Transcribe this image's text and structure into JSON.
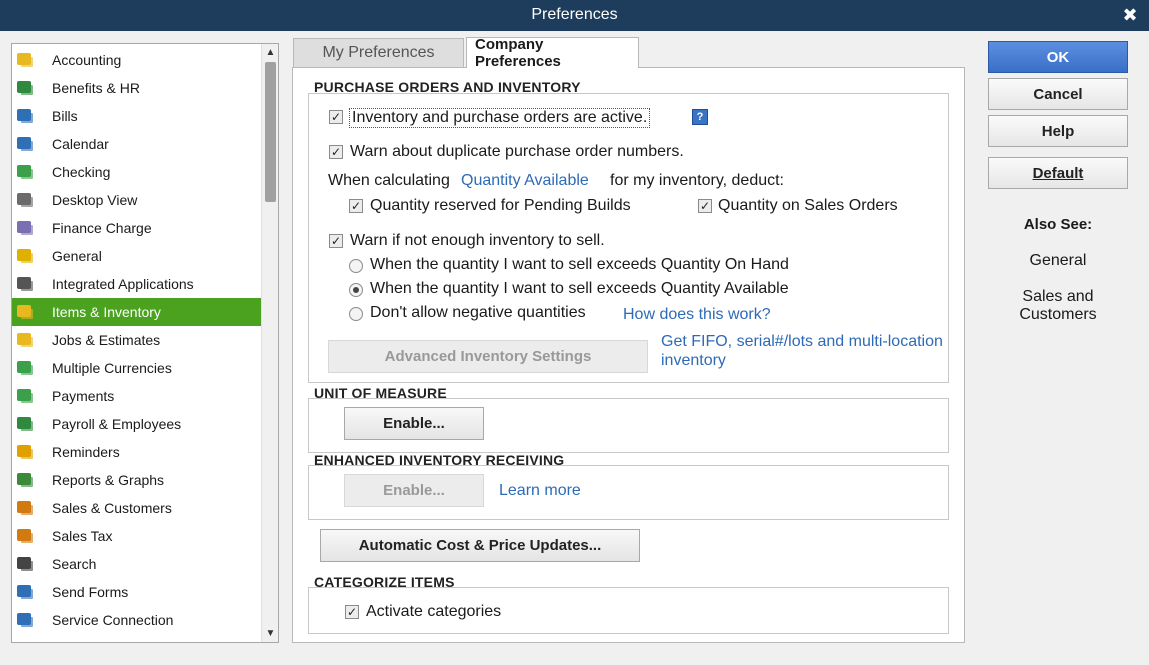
{
  "window": {
    "title": "Preferences",
    "close_glyph": "✖"
  },
  "sidebar": {
    "items": [
      {
        "label": "Accounting",
        "icon": "accounting-icon",
        "color": "#e8b820"
      },
      {
        "label": "Benefits & HR",
        "icon": "benefits-hr-icon",
        "color": "#2f8a3e"
      },
      {
        "label": "Bills",
        "icon": "bills-icon",
        "color": "#2f6fb5"
      },
      {
        "label": "Calendar",
        "icon": "calendar-icon",
        "color": "#2f6fb5"
      },
      {
        "label": "Checking",
        "icon": "checking-icon",
        "color": "#3aa04a"
      },
      {
        "label": "Desktop View",
        "icon": "desktop-view-icon",
        "color": "#6b6b6b"
      },
      {
        "label": "Finance Charge",
        "icon": "finance-charge-icon",
        "color": "#7a6fb0"
      },
      {
        "label": "General",
        "icon": "general-icon",
        "color": "#e0b000"
      },
      {
        "label": "Integrated Applications",
        "icon": "integrated-apps-icon",
        "color": "#555555"
      },
      {
        "label": "Items & Inventory",
        "icon": "items-inventory-icon",
        "color": "#e8b820"
      },
      {
        "label": "Jobs & Estimates",
        "icon": "jobs-estimates-icon",
        "color": "#e8b820"
      },
      {
        "label": "Multiple Currencies",
        "icon": "multiple-currencies-icon",
        "color": "#3aa04a"
      },
      {
        "label": "Payments",
        "icon": "payments-icon",
        "color": "#3aa04a"
      },
      {
        "label": "Payroll & Employees",
        "icon": "payroll-employees-icon",
        "color": "#2f8a3e"
      },
      {
        "label": "Reminders",
        "icon": "reminders-icon",
        "color": "#e0a000"
      },
      {
        "label": "Reports & Graphs",
        "icon": "reports-graphs-icon",
        "color": "#3a8a3a"
      },
      {
        "label": "Sales & Customers",
        "icon": "sales-customers-icon",
        "color": "#d07a10"
      },
      {
        "label": "Sales Tax",
        "icon": "sales-tax-icon",
        "color": "#d07a10"
      },
      {
        "label": "Search",
        "icon": "search-icon",
        "color": "#444444"
      },
      {
        "label": "Send Forms",
        "icon": "send-forms-icon",
        "color": "#2f6fb5"
      },
      {
        "label": "Service Connection",
        "icon": "service-connection-icon",
        "color": "#2f6fb5"
      }
    ],
    "selected": "Items & Inventory",
    "selected_color": "#4aa21e"
  },
  "tabs": {
    "my_preferences": "My Preferences",
    "company_preferences": "Company Preferences"
  },
  "purchase_orders": {
    "title": "PURCHASE ORDERS AND INVENTORY",
    "inventory_active": "Inventory and purchase orders are active.",
    "warn_duplicate": "Warn about duplicate purchase order numbers.",
    "when_calculating": "When calculating",
    "quantity_available_link": "Quantity Available",
    "for_my_inventory": "for my inventory, deduct:",
    "pending_builds": "Quantity reserved for Pending Builds",
    "sales_orders": "Quantity on Sales Orders",
    "warn_not_enough": "Warn if not enough inventory to sell.",
    "exceeds_on_hand": "When the quantity I want to sell exceeds Quantity On Hand",
    "exceeds_available": "When the quantity I want to sell exceeds Quantity Available",
    "dont_allow_negative": "Don't allow negative quantities",
    "how_does_this_work": "How does this work?",
    "advanced_settings": "Advanced Inventory Settings",
    "fifo_link_line1": "Get FIFO, serial#/lots and multi-location",
    "fifo_link_line2": "inventory",
    "help_glyph": "?"
  },
  "unit_of_measure": {
    "title": "UNIT OF MEASURE",
    "enable": "Enable..."
  },
  "enhanced_receiving": {
    "title": "ENHANCED INVENTORY RECEIVING",
    "enable": "Enable...",
    "learn_more": "Learn more"
  },
  "auto_cost": {
    "label": "Automatic Cost & Price Updates..."
  },
  "categorize": {
    "title": "CATEGORIZE ITEMS",
    "activate": "Activate categories"
  },
  "checkbox_states": {
    "inventory_active": true,
    "warn_duplicate": true,
    "pending_builds": true,
    "sales_orders": true,
    "warn_not_enough": true,
    "activate_categories": true
  },
  "radio_selected": "exceeds_available",
  "buttons": {
    "ok": "OK",
    "cancel": "Cancel",
    "help": "Help",
    "default": "Default"
  },
  "also_see": {
    "title": "Also See:",
    "general": "General",
    "sales_line1": "Sales and",
    "sales_line2": "Customers"
  },
  "colors": {
    "titlebar": "#1e3d5c",
    "link": "#2e6ab6",
    "ok_button": "#3a6fc8"
  }
}
